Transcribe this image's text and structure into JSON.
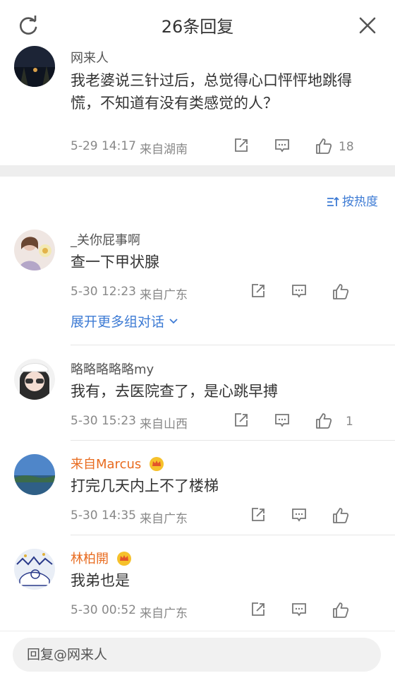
{
  "header": {
    "title": "26条回复"
  },
  "original": {
    "user": "网来人",
    "text_line1": "我老婆说三针过后，总觉得心口怦怦地跳得",
    "text_line2": "慌，不知道有没有类感觉的人？",
    "time": "5-29 14:17",
    "source": "来自湖南",
    "likes": "18"
  },
  "sort_label": "按热度",
  "comments": [
    {
      "user": "_关你屁事啊",
      "text": "查一下甲状腺",
      "time": "5-30 12:23",
      "source": "来自广东",
      "likes": "",
      "expand": "展开更多组对话"
    },
    {
      "user": "略略略略略my",
      "text": "我有，去医院查了，是心跳早搏",
      "time": "5-30 15:23",
      "source": "来自山西",
      "likes": "1"
    },
    {
      "user": "来自Marcus",
      "text": "打完几天内上不了楼梯",
      "time": "5-30 14:35",
      "source": "来自广东",
      "likes": ""
    },
    {
      "user": "林柏開",
      "text": "我弟也是",
      "time": "5-30 00:52",
      "source": "来自广东",
      "likes": ""
    }
  ],
  "reply": {
    "placeholder": "回复@网来人"
  },
  "colors": {
    "link": "#3d7bd4",
    "vip_name": "#e86b1f",
    "separator": "#eeeeee"
  }
}
